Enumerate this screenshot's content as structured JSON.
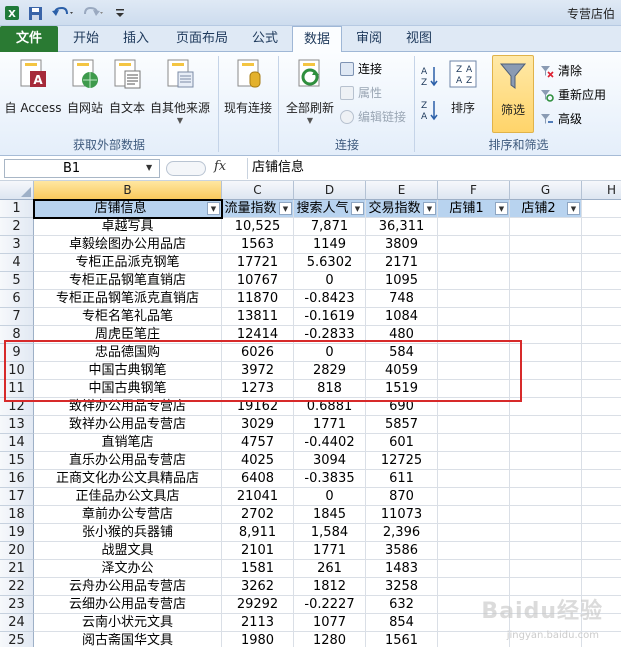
{
  "title_text": "专营店伯",
  "tabs": [
    "文件",
    "开始",
    "插入",
    "页面布局",
    "公式",
    "数据",
    "审阅",
    "视图"
  ],
  "ribbon": {
    "get_external": {
      "buttons": [
        "自 Access",
        "自网站",
        "自文本",
        "自其他来源"
      ],
      "label": "获取外部数据"
    },
    "existing_conn": "现有连接",
    "connections": {
      "refresh_all": "全部刷新",
      "small": [
        "连接",
        "属性",
        "编辑链接"
      ],
      "label": "连接"
    },
    "sort_filter": {
      "sort": "排序",
      "filter": "筛选",
      "small": [
        "清除",
        "重新应用",
        "高级"
      ],
      "label": "排序和筛选"
    }
  },
  "formula_bar": {
    "name_box": "B1",
    "fx": "fx",
    "value": "店铺信息"
  },
  "columns": [
    "B",
    "C",
    "D",
    "E",
    "F",
    "G",
    "H"
  ],
  "headers": [
    "店铺信息",
    "流量指数",
    "搜索人气",
    "交易指数",
    "店铺1",
    "店铺2",
    ""
  ],
  "row_numbers": [
    "1",
    "2",
    "3",
    "4",
    "5",
    "6",
    "7",
    "8",
    "9",
    "10",
    "11",
    "12",
    "13",
    "14",
    "15",
    "16",
    "17",
    "18",
    "19",
    "20",
    "21",
    "22",
    "23",
    "24",
    "25"
  ],
  "rows": [
    [
      "卓越写具",
      "10,525",
      "7,871",
      "36,311"
    ],
    [
      "卓毅绘图办公用品店",
      "1563",
      "1149",
      "3809"
    ],
    [
      "专柜正品派克钢笔",
      "17721",
      "5.6302",
      "2171"
    ],
    [
      "专柜正品钢笔直销店",
      "10767",
      "0",
      "1095"
    ],
    [
      "专柜正品钢笔派克直销店",
      "11870",
      "-0.8423",
      "748"
    ],
    [
      "专柜名笔礼品笔",
      "13811",
      "-0.1619",
      "1084"
    ],
    [
      "周虎臣笔庄",
      "12414",
      "-0.2833",
      "480"
    ],
    [
      "忠品德国购",
      "6026",
      "0",
      "584"
    ],
    [
      "中国古典钢笔",
      "3972",
      "2829",
      "4059"
    ],
    [
      "中国古典钢笔",
      "1273",
      "818",
      "1519"
    ],
    [
      "致祥办公用品专营店",
      "19162",
      "0.6881",
      "690"
    ],
    [
      "致祥办公用品专营店",
      "3029",
      "1771",
      "5857"
    ],
    [
      "直销笔店",
      "4757",
      "-0.4402",
      "601"
    ],
    [
      "直乐办公用品专营店",
      "4025",
      "3094",
      "12725"
    ],
    [
      "正商文化办公文具精品店",
      "6408",
      "-0.3835",
      "611"
    ],
    [
      "正佳品办公文具店",
      "21041",
      "0",
      "870"
    ],
    [
      "章前办公专营店",
      "2702",
      "1845",
      "11073"
    ],
    [
      "张小猴的兵器铺",
      "8,911",
      "1,584",
      "2,396"
    ],
    [
      "战盟文具",
      "2101",
      "1771",
      "3586"
    ],
    [
      "泽文办公",
      "1581",
      "261",
      "1483"
    ],
    [
      "云舟办公用品专营店",
      "3262",
      "1812",
      "3258"
    ],
    [
      "云细办公用品专营店",
      "29292",
      "-0.2227",
      "632"
    ],
    [
      "云南小状元文具",
      "2113",
      "1077",
      "854"
    ],
    [
      "阅古斋国华文具",
      "1980",
      "1280",
      "1561"
    ]
  ],
  "watermark": "Baidu经验",
  "watermark_sub": "jingyan.baidu.com"
}
